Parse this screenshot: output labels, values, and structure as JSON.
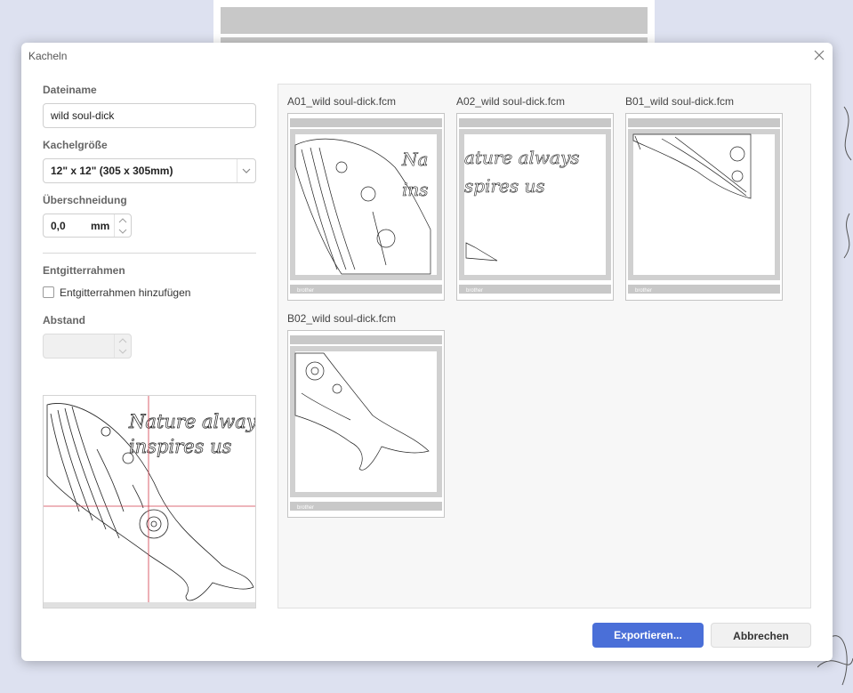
{
  "dialog": {
    "title": "Kacheln",
    "close_icon": "close-icon"
  },
  "form": {
    "filename": {
      "label": "Dateiname",
      "value": "wild soul-dick"
    },
    "tile_size": {
      "label": "Kachelgröße",
      "selected": "12\" x 12\" (305 x 305mm)"
    },
    "overlap": {
      "label": "Überschneidung",
      "value": "0,0",
      "unit": "mm"
    },
    "weeding": {
      "section": "Entgitterrahmen",
      "checkbox_label": "Entgitterrahmen hinzufügen",
      "checked": false
    },
    "spacing": {
      "label": "Abstand",
      "value": ""
    }
  },
  "preview": {
    "text": "Nature always\ninspires us",
    "line1": "Nature always",
    "line2": "inspires us"
  },
  "tiles": [
    {
      "id": "A01",
      "label": "A01_wild soul-dick.fcm",
      "brand": "brother"
    },
    {
      "id": "A02",
      "label": "A02_wild soul-dick.fcm",
      "brand": "brother"
    },
    {
      "id": "B01",
      "label": "B01_wild soul-dick.fcm",
      "brand": "brother"
    },
    {
      "id": "B02",
      "label": "B02_wild soul-dick.fcm",
      "brand": "brother"
    }
  ],
  "buttons": {
    "export": "Exportieren...",
    "cancel": "Abbrechen"
  },
  "colors": {
    "accent": "#4a6fd8",
    "crosshair": "#d23a4a"
  }
}
